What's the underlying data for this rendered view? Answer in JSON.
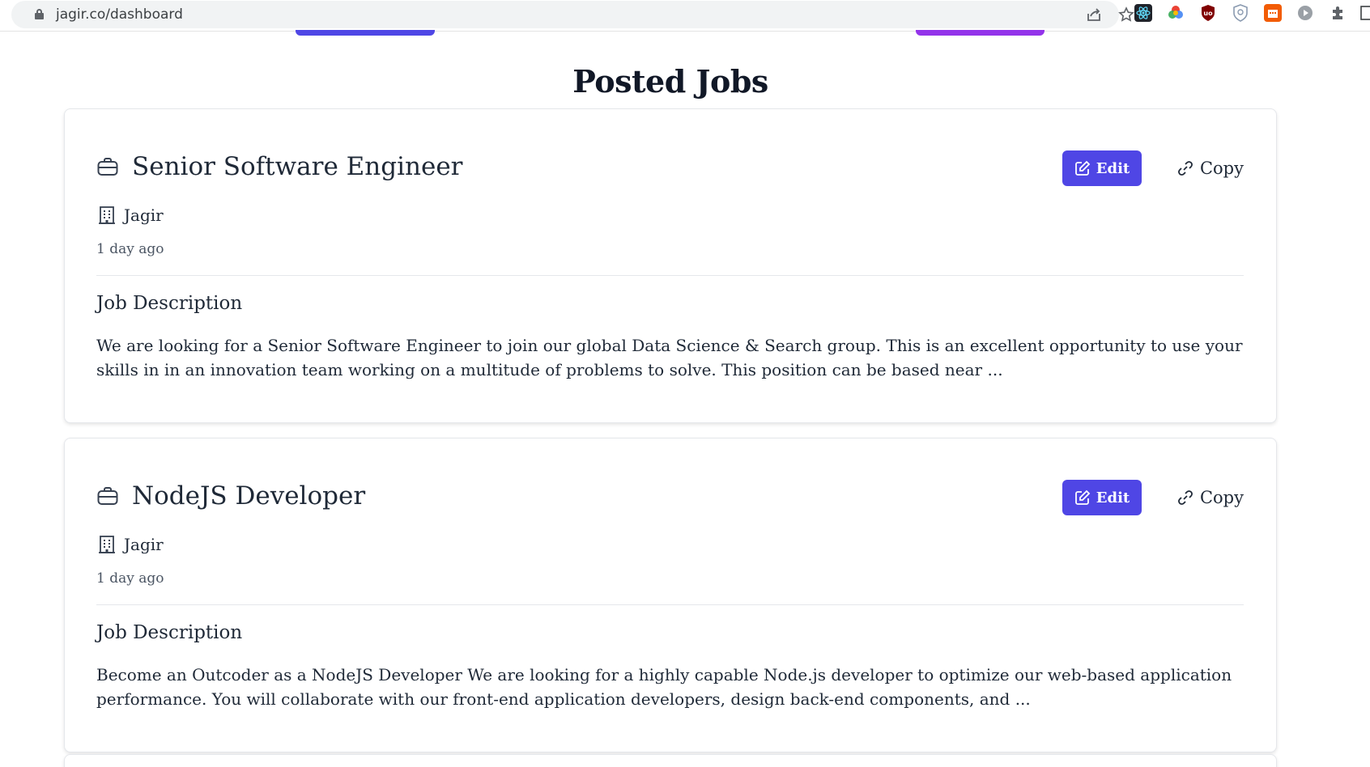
{
  "browser": {
    "url": "jagir.co/dashboard",
    "extensions": [
      "react-devtools-icon",
      "color-picker-icon",
      "ublock-icon",
      "shield-extension-icon",
      "calendar-extension-icon",
      "play-extension-icon",
      "puzzle-icon"
    ]
  },
  "page": {
    "title": "Posted Jobs"
  },
  "jobs": [
    {
      "title": "Senior Software Engineer",
      "company": "Jagir",
      "posted": "1 day ago",
      "description_heading": "Job Description",
      "description": "We are looking for a Senior Software Engineer to join our global Data Science & Search group. This is an excellent opportunity to use your skills in in an innovation team working on a multitude of problems to solve. This position can be based near ...",
      "edit_label": "Edit",
      "copy_label": "Copy"
    },
    {
      "title": "NodeJS Developer",
      "company": "Jagir",
      "posted": "1 day ago",
      "description_heading": "Job Description",
      "description": "Become an Outcoder as a NodeJS Developer We are looking for a highly capable Node.js developer to optimize our web-based application performance. You will collaborate with our front-end application developers, design back-end components, and ...",
      "edit_label": "Edit",
      "copy_label": "Copy"
    }
  ],
  "colors": {
    "primary": "#4f46e5",
    "secondary": "#9333ea"
  }
}
